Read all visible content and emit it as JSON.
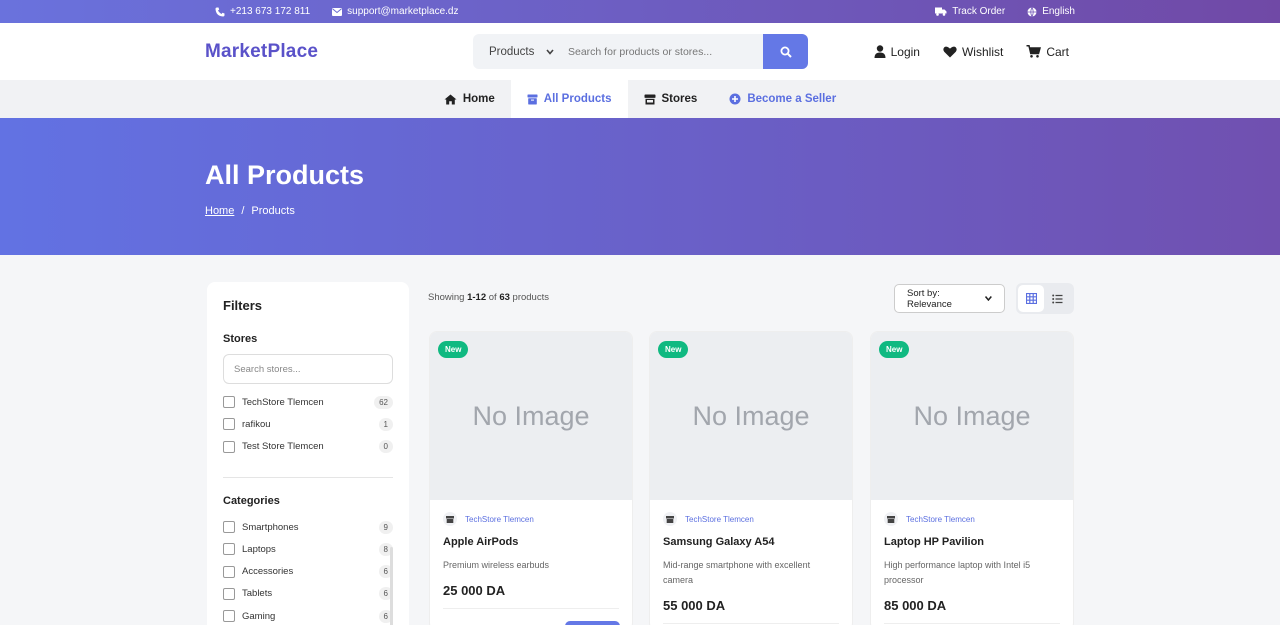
{
  "topbar": {
    "phone": "+213 673 172 811",
    "email": "support@marketplace.dz",
    "track_order": "Track Order",
    "language": "English"
  },
  "header": {
    "logo": "MarketPlace",
    "search_category": "Products",
    "search_placeholder": "Search for products or stores...",
    "login": "Login",
    "wishlist": "Wishlist",
    "cart": "Cart"
  },
  "nav": {
    "items": [
      {
        "label": "Home"
      },
      {
        "label": "All Products"
      },
      {
        "label": "Stores"
      },
      {
        "label": "Become a Seller"
      }
    ]
  },
  "hero": {
    "title": "All Products",
    "breadcrumb_home": "Home",
    "breadcrumb_sep": "/",
    "breadcrumb_current": "Products"
  },
  "filters": {
    "title": "Filters",
    "stores_heading": "Stores",
    "stores_search_placeholder": "Search stores...",
    "stores": [
      {
        "name": "TechStore Tlemcen",
        "count": "62"
      },
      {
        "name": "rafikou",
        "count": "1"
      },
      {
        "name": "Test Store Tlemcen",
        "count": "0"
      }
    ],
    "categories_heading": "Categories",
    "categories": [
      {
        "name": "Smartphones",
        "count": "9"
      },
      {
        "name": "Laptops",
        "count": "8"
      },
      {
        "name": "Accessories",
        "count": "6"
      },
      {
        "name": "Tablets",
        "count": "6"
      },
      {
        "name": "Gaming",
        "count": "6"
      }
    ]
  },
  "results": {
    "showing_prefix": "Showing",
    "range": "1-12",
    "of": "of",
    "total": "63",
    "suffix": "products",
    "sort": "Sort by: Relevance"
  },
  "products": [
    {
      "badge": "New",
      "image_text": "No Image",
      "store": "TechStore Tlemcen",
      "name": "Apple AirPods",
      "desc": "Premium wireless earbuds",
      "price": "25 000 DA"
    },
    {
      "badge": "New",
      "image_text": "No Image",
      "store": "TechStore Tlemcen",
      "name": "Samsung Galaxy A54",
      "desc": "Mid-range smartphone with excellent camera",
      "price": "55 000 DA"
    },
    {
      "badge": "New",
      "image_text": "No Image",
      "store": "TechStore Tlemcen",
      "name": "Laptop HP Pavilion",
      "desc": "High performance laptop with Intel i5 processor",
      "price": "85 000 DA"
    }
  ],
  "colors": {
    "accent": "#6478e6",
    "new_badge": "#10b981",
    "gradient_start": "#6272e3",
    "gradient_end": "#7050b0"
  }
}
